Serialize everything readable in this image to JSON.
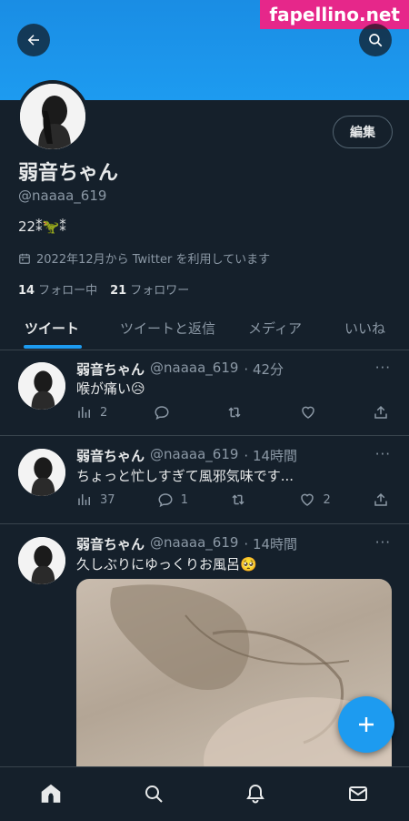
{
  "watermark": "fapellino.net",
  "profile": {
    "name": "弱音ちゃん",
    "handle": "@naaaa_619",
    "bio": "22⁑🦖⁑",
    "joined": "2022年12月から Twitter を利用しています",
    "following_count": "14",
    "following_label": "フォロー中",
    "followers_count": "21",
    "followers_label": "フォロワー",
    "edit_label": "編集"
  },
  "tabs": [
    {
      "label": "ツイート",
      "active": true
    },
    {
      "label": "ツイートと返信",
      "active": false
    },
    {
      "label": "メディア",
      "active": false
    },
    {
      "label": "いいね",
      "active": false
    }
  ],
  "tweets": [
    {
      "name": "弱音ちゃん",
      "handle": "@naaaa_619",
      "time": "· 42分",
      "text": "喉が痛い😥",
      "views": "2",
      "replies": "",
      "retweets": "",
      "likes": ""
    },
    {
      "name": "弱音ちゃん",
      "handle": "@naaaa_619",
      "time": "· 14時間",
      "text": "ちょっと忙しすぎて風邪気味です...",
      "views": "37",
      "replies": "1",
      "retweets": "",
      "likes": "2"
    },
    {
      "name": "弱音ちゃん",
      "handle": "@naaaa_619",
      "time": "· 14時間",
      "text": "久しぶりにゆっくりお風呂🥺"
    }
  ],
  "more_icon": "···",
  "colors": {
    "accent": "#1d9bf0",
    "background": "#15202b",
    "secondary_text": "#8b98a5",
    "watermark": "#e6278a"
  }
}
